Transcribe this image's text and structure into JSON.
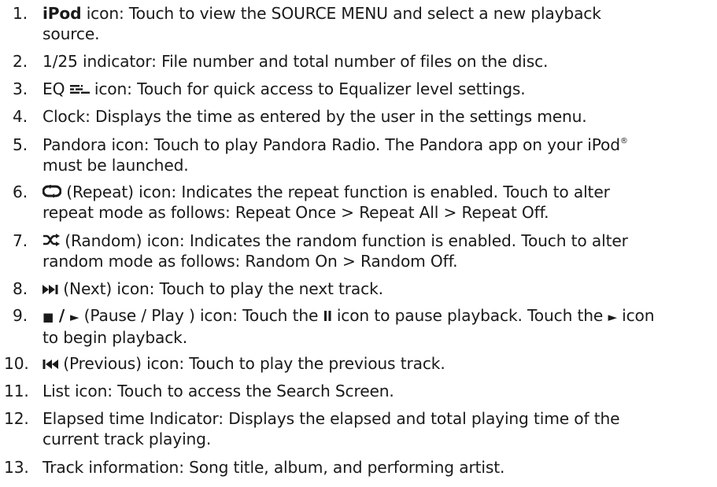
{
  "items": [
    {
      "num": "1.",
      "bold": "iPod",
      "rest": " icon: Touch to view the SOURCE MENU and select a new playback",
      "line2": "source."
    },
    {
      "num": "2.",
      "text": "1/25 indicator: File number and total number of files on the disc."
    },
    {
      "num": "3.",
      "pre": "EQ ",
      "post": " icon: Touch for quick access to Equalizer level settings.",
      "icon": "eq-bars-icon"
    },
    {
      "num": "4.",
      "text": "Clock: Displays the time as entered by the user in the settings menu."
    },
    {
      "num": "5.",
      "line1": "Pandora icon: Touch to play Pandora Radio. The Pandora app on your iPod",
      "reg": "®",
      "line2": "must be launched."
    },
    {
      "num": "6.",
      "post": " (Repeat) icon: Indicates the repeat function is enabled. Touch to alter",
      "line2": "repeat mode as follows: Repeat Once > Repeat All > Repeat Off.",
      "icon": "repeat-icon"
    },
    {
      "num": "7.",
      "post": " (Random) icon: Indicates the random function is enabled. Touch to alter",
      "line2": "random mode as follows: Random On > Random Off.",
      "icon": "shuffle-icon"
    },
    {
      "num": "8.",
      "post": " (Next) icon: Touch to play the next track.",
      "icon": "next-track-icon"
    },
    {
      "num": "9.",
      "pause_glyph": "■",
      "slash": " / ",
      "play_glyph": "►",
      "mid": " (Pause / Play ) icon: Touch the ",
      "mid2": " icon to pause playback. Touch the ",
      "play_glyph2": "►",
      "end": " icon",
      "line2": "to begin playback.",
      "icon": "pause-play-icon"
    },
    {
      "num": "10.",
      "post": " (Previous) icon: Touch to play the previous track.",
      "icon": "previous-track-icon"
    },
    {
      "num": "11.",
      "text": "List icon: Touch to access the Search Screen."
    },
    {
      "num": "12.",
      "line1": "Elapsed time Indicator: Displays the elapsed and total playing time of the",
      "line2": "current track playing."
    },
    {
      "num": "13.",
      "text": "Track information: Song title, album, and performing artist."
    }
  ]
}
